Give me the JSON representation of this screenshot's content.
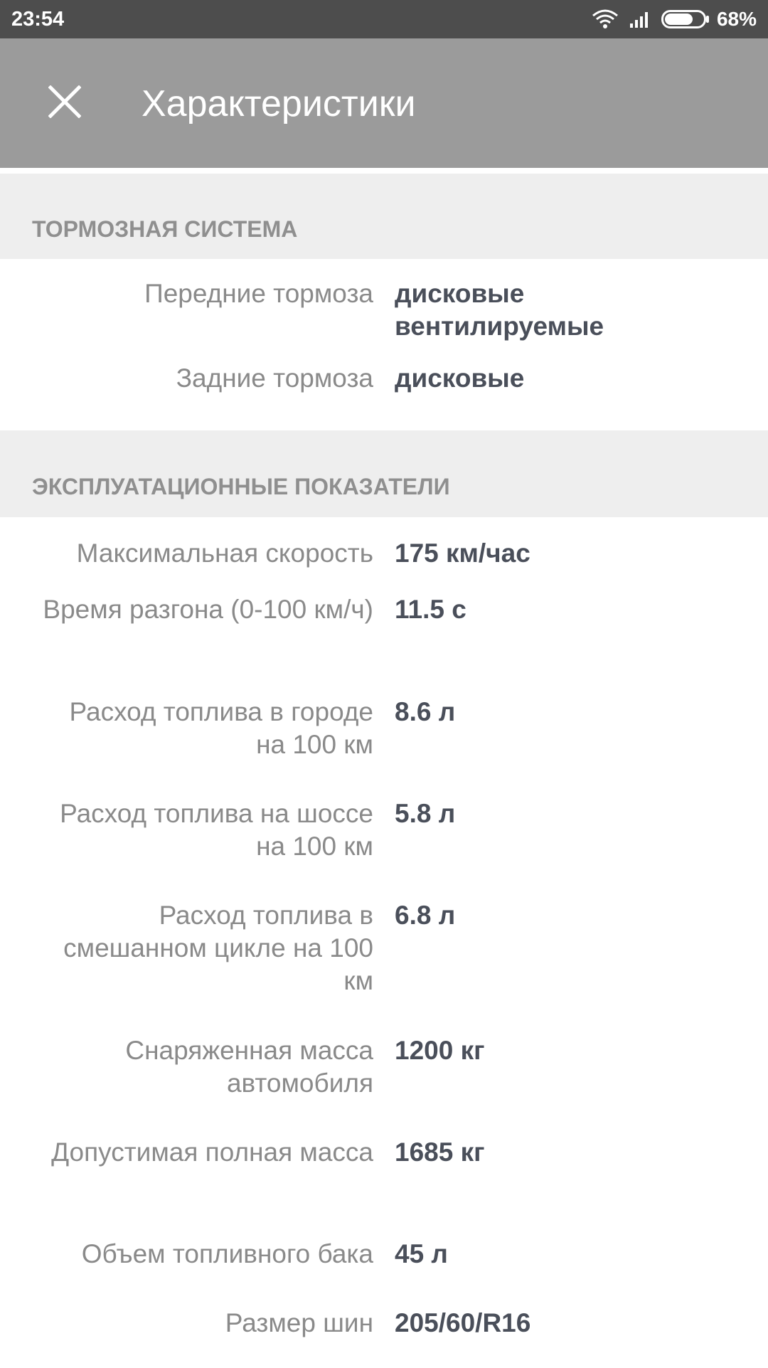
{
  "status_bar": {
    "time": "23:54",
    "battery": "68%",
    "icons": [
      "wifi-icon",
      "signal-icon",
      "battery-icon"
    ]
  },
  "app_bar": {
    "close_icon": "close-icon",
    "title": "Характеристики"
  },
  "sections": [
    {
      "title": "ТОРМОЗНАЯ СИСТЕМА",
      "rows": [
        {
          "label": "Передние тормоза",
          "value": "дисковые вентилируемые"
        },
        {
          "label": "Задние тормоза",
          "value": "дисковые"
        }
      ]
    },
    {
      "title": "ЭКСПЛУАТАЦИОННЫЕ ПОКАЗАТЕЛИ",
      "rows": [
        {
          "label": "Максимальная скорость",
          "value": "175 км/час"
        },
        {
          "label": "Время разгона (0-100 км/ч)",
          "value": "11.5 с"
        },
        {
          "label": "Расход топлива в городе на 100 км",
          "value": "8.6 л"
        },
        {
          "label": "Расход топлива на шоссе на 100 км",
          "value": "5.8 л"
        },
        {
          "label": "Расход топлива в смешанном цикле на 100 км",
          "value": "6.8 л"
        },
        {
          "label": "Снаряженная масса автомобиля",
          "value": "1200 кг"
        },
        {
          "label": "Допустимая полная масса",
          "value": "1685 кг"
        },
        {
          "label": "Объем топливного бака",
          "value": "45 л"
        },
        {
          "label": "Размер шин",
          "value": "205/60/R16"
        }
      ]
    }
  ],
  "colors": {
    "status_bar": "#4d4d4d",
    "app_bar": "#9b9b9b",
    "section_bg": "#eeeeee",
    "label_text": "#8a8a8a",
    "value_text": "#4a4f5a"
  }
}
